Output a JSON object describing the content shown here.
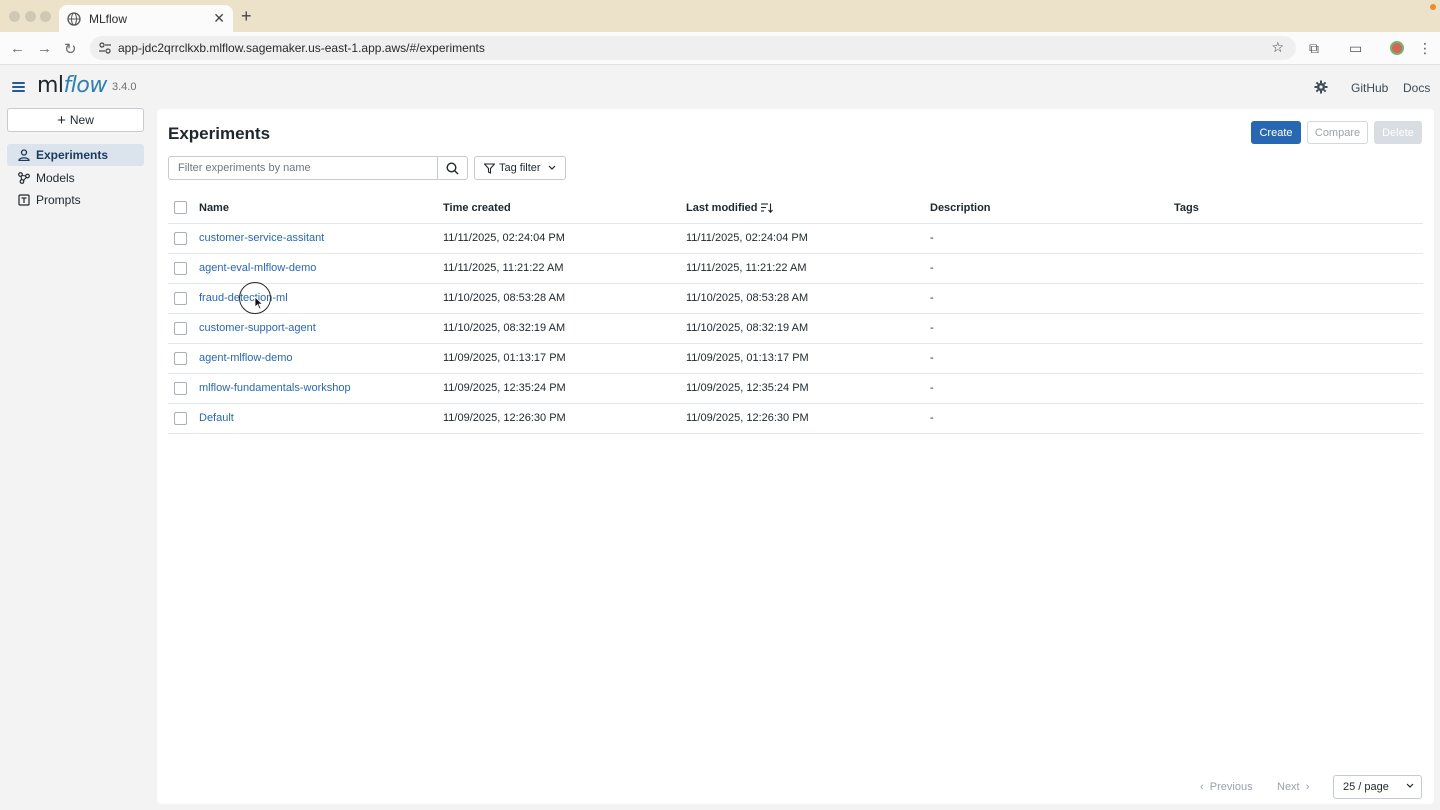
{
  "browser": {
    "tab_title": "MLflow",
    "url": "app-jdc2qrrclkxb.mlflow.sagemaker.us-east-1.app.aws/#/experiments"
  },
  "header": {
    "logo_ml": "ml",
    "logo_flow": "flow",
    "version": "3.4.0",
    "github": "GitHub",
    "docs": "Docs"
  },
  "sidebar": {
    "new_label": "New",
    "items": [
      {
        "label": "Experiments",
        "icon": "user-icon",
        "active": true
      },
      {
        "label": "Models",
        "icon": "models-icon",
        "active": false
      },
      {
        "label": "Prompts",
        "icon": "prompts-icon",
        "active": false
      }
    ]
  },
  "main": {
    "title": "Experiments",
    "create_label": "Create",
    "compare_label": "Compare",
    "delete_label": "Delete",
    "filter_placeholder": "Filter experiments by name",
    "tag_filter_label": "Tag filter",
    "columns": {
      "name": "Name",
      "time_created": "Time created",
      "last_modified": "Last modified",
      "description": "Description",
      "tags": "Tags"
    },
    "rows": [
      {
        "name": "customer-service-assitant",
        "created": "11/11/2025, 02:24:04 PM",
        "modified": "11/11/2025, 02:24:04 PM",
        "description": "-",
        "tags": ""
      },
      {
        "name": "agent-eval-mlflow-demo",
        "created": "11/11/2025, 11:21:22 AM",
        "modified": "11/11/2025, 11:21:22 AM",
        "description": "-",
        "tags": ""
      },
      {
        "name": "fraud-detection-ml",
        "created": "11/10/2025, 08:53:28 AM",
        "modified": "11/10/2025, 08:53:28 AM",
        "description": "-",
        "tags": ""
      },
      {
        "name": "customer-support-agent",
        "created": "11/10/2025, 08:32:19 AM",
        "modified": "11/10/2025, 08:32:19 AM",
        "description": "-",
        "tags": ""
      },
      {
        "name": "agent-mlflow-demo",
        "created": "11/09/2025, 01:13:17 PM",
        "modified": "11/09/2025, 01:13:17 PM",
        "description": "-",
        "tags": ""
      },
      {
        "name": "mlflow-fundamentals-workshop",
        "created": "11/09/2025, 12:35:24 PM",
        "modified": "11/09/2025, 12:35:24 PM",
        "description": "-",
        "tags": ""
      },
      {
        "name": "Default",
        "created": "11/09/2025, 12:26:30 PM",
        "modified": "11/09/2025, 12:26:30 PM",
        "description": "-",
        "tags": ""
      }
    ],
    "pagination": {
      "previous": "Previous",
      "next": "Next",
      "page_size": "25 / page"
    }
  },
  "colors": {
    "primary": "#2867b2",
    "link": "#2867b2",
    "sidebar_active": "#dbe4ec"
  }
}
